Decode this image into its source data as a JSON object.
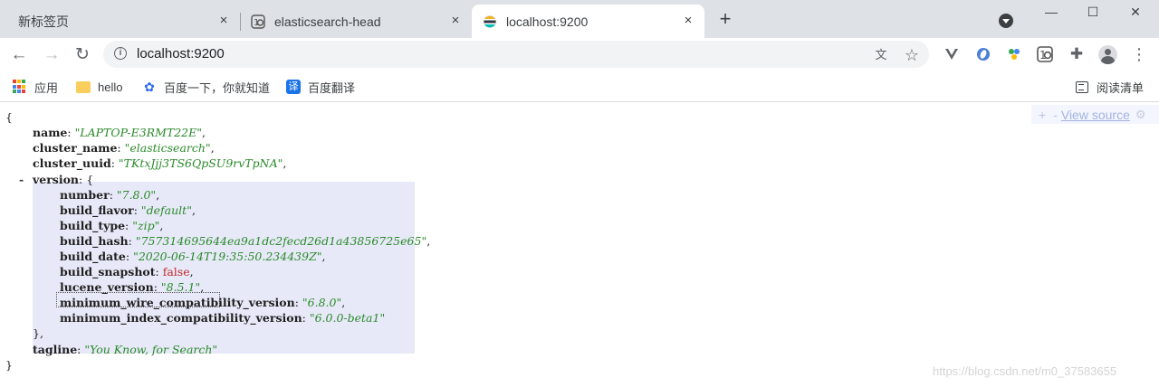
{
  "tabs": [
    {
      "title": "新标签页",
      "active": false
    },
    {
      "title": "elasticsearch-head",
      "active": false
    },
    {
      "title": "localhost:9200",
      "active": true
    }
  ],
  "icons": {
    "close": "×",
    "new_tab": "+",
    "back": "←",
    "forward": "→",
    "reload": "↻",
    "minimize": "—",
    "maximize": "☐",
    "close_window": "✕",
    "star": "☆",
    "translate": "文",
    "extensions": "✚",
    "menu": "⋮",
    "info": "i",
    "gear": "⚙"
  },
  "address_bar": {
    "url": "localhost:9200"
  },
  "bookmarks": [
    {
      "label": "应用",
      "icon": "apps-icon"
    },
    {
      "label": "hello",
      "icon": "folder-icon"
    },
    {
      "label": "百度一下，你就知道",
      "icon": "baidu-paw-icon"
    },
    {
      "label": "百度翻译",
      "icon": "baidu-translate-icon"
    }
  ],
  "reading_list": "阅读清单",
  "json_viewer": {
    "view_source": "View source",
    "plus": "+",
    "minus": "-",
    "open_brace": "{",
    "close_brace": "}",
    "name": {
      "key": "name",
      "value": "\"LAPTOP-E3RMT22E\""
    },
    "cluster_name": {
      "key": "cluster_name",
      "value": "\"elasticsearch\""
    },
    "cluster_uuid": {
      "key": "cluster_uuid",
      "value": "\"TKtxJjj3TS6QpSU9rvTpNA\""
    },
    "version": {
      "key": "version",
      "collapse": "-",
      "number": {
        "key": "number",
        "value": "\"7.8.0\""
      },
      "build_flavor": {
        "key": "build_flavor",
        "value": "\"default\""
      },
      "build_type": {
        "key": "build_type",
        "value": "\"zip\""
      },
      "build_hash": {
        "key": "build_hash",
        "value": "\"757314695644ea9a1dc2fecd26d1a43856725e65\""
      },
      "build_date": {
        "key": "build_date",
        "value": "\"2020-06-14T19:35:50.234439Z\""
      },
      "build_snapshot": {
        "key": "build_snapshot",
        "value": "false"
      },
      "lucene_version": {
        "key": "lucene_version",
        "value": "\"8.5.1\""
      },
      "minimum_wire_compatibility_version": {
        "key": "minimum_wire_compatibility_version",
        "value": "\"6.8.0\""
      },
      "minimum_index_compatibility_version": {
        "key": "minimum_index_compatibility_version",
        "value": "\"6.0.0-beta1\""
      }
    },
    "tagline": {
      "key": "tagline",
      "value": "\"You Know, for Search\""
    }
  },
  "watermark": "https://blog.csdn.net/m0_37583655",
  "colors": {
    "string": "#2a8a2a",
    "boolean": "#c52828",
    "highlight": "#e7e9f8",
    "tabstrip": "#dee1e6"
  }
}
